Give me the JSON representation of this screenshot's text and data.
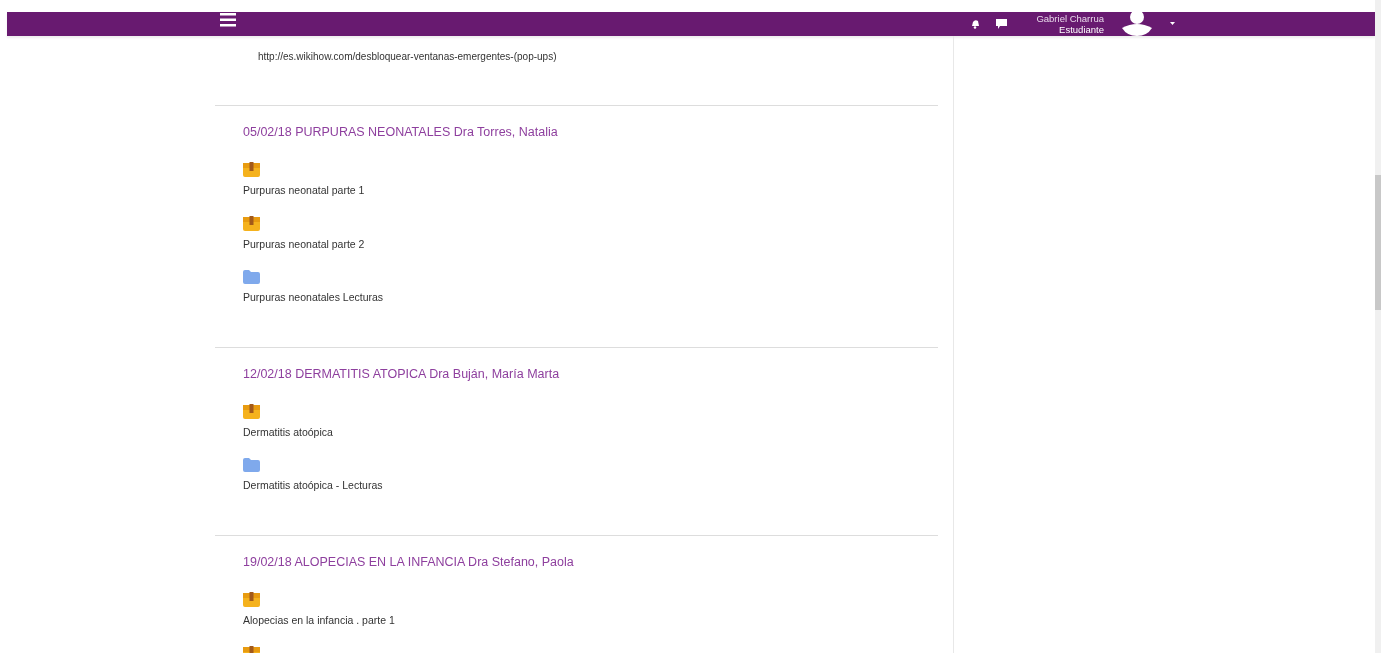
{
  "header": {
    "user_name": "Gabriel Charrua",
    "user_role": "Estudiante"
  },
  "intro_link": "http://es.wikihow.com/desbloquear-ventanas-emergentes-(pop-ups)",
  "sections": [
    {
      "title": "05/02/18 PURPURAS NEONATALES Dra Torres, Natalia",
      "items": [
        {
          "kind": "package",
          "label": "Purpuras neonatal parte 1"
        },
        {
          "kind": "package",
          "label": "Purpuras neonatal parte 2"
        },
        {
          "kind": "folder",
          "label": "Purpuras neonatales Lecturas"
        }
      ]
    },
    {
      "title": "12/02/18 DERMATITIS ATOPICA Dra Buján, María Marta",
      "items": [
        {
          "kind": "package",
          "label": "Dermatitis atoópica"
        },
        {
          "kind": "folder",
          "label": "Dermatitis atoópica - Lecturas"
        }
      ]
    },
    {
      "title": "19/02/18 ALOPECIAS EN LA INFANCIA Dra Stefano, Paola",
      "items": [
        {
          "kind": "package",
          "label": "Alopecias en la infancia . parte 1"
        },
        {
          "kind": "package"
        }
      ]
    }
  ]
}
